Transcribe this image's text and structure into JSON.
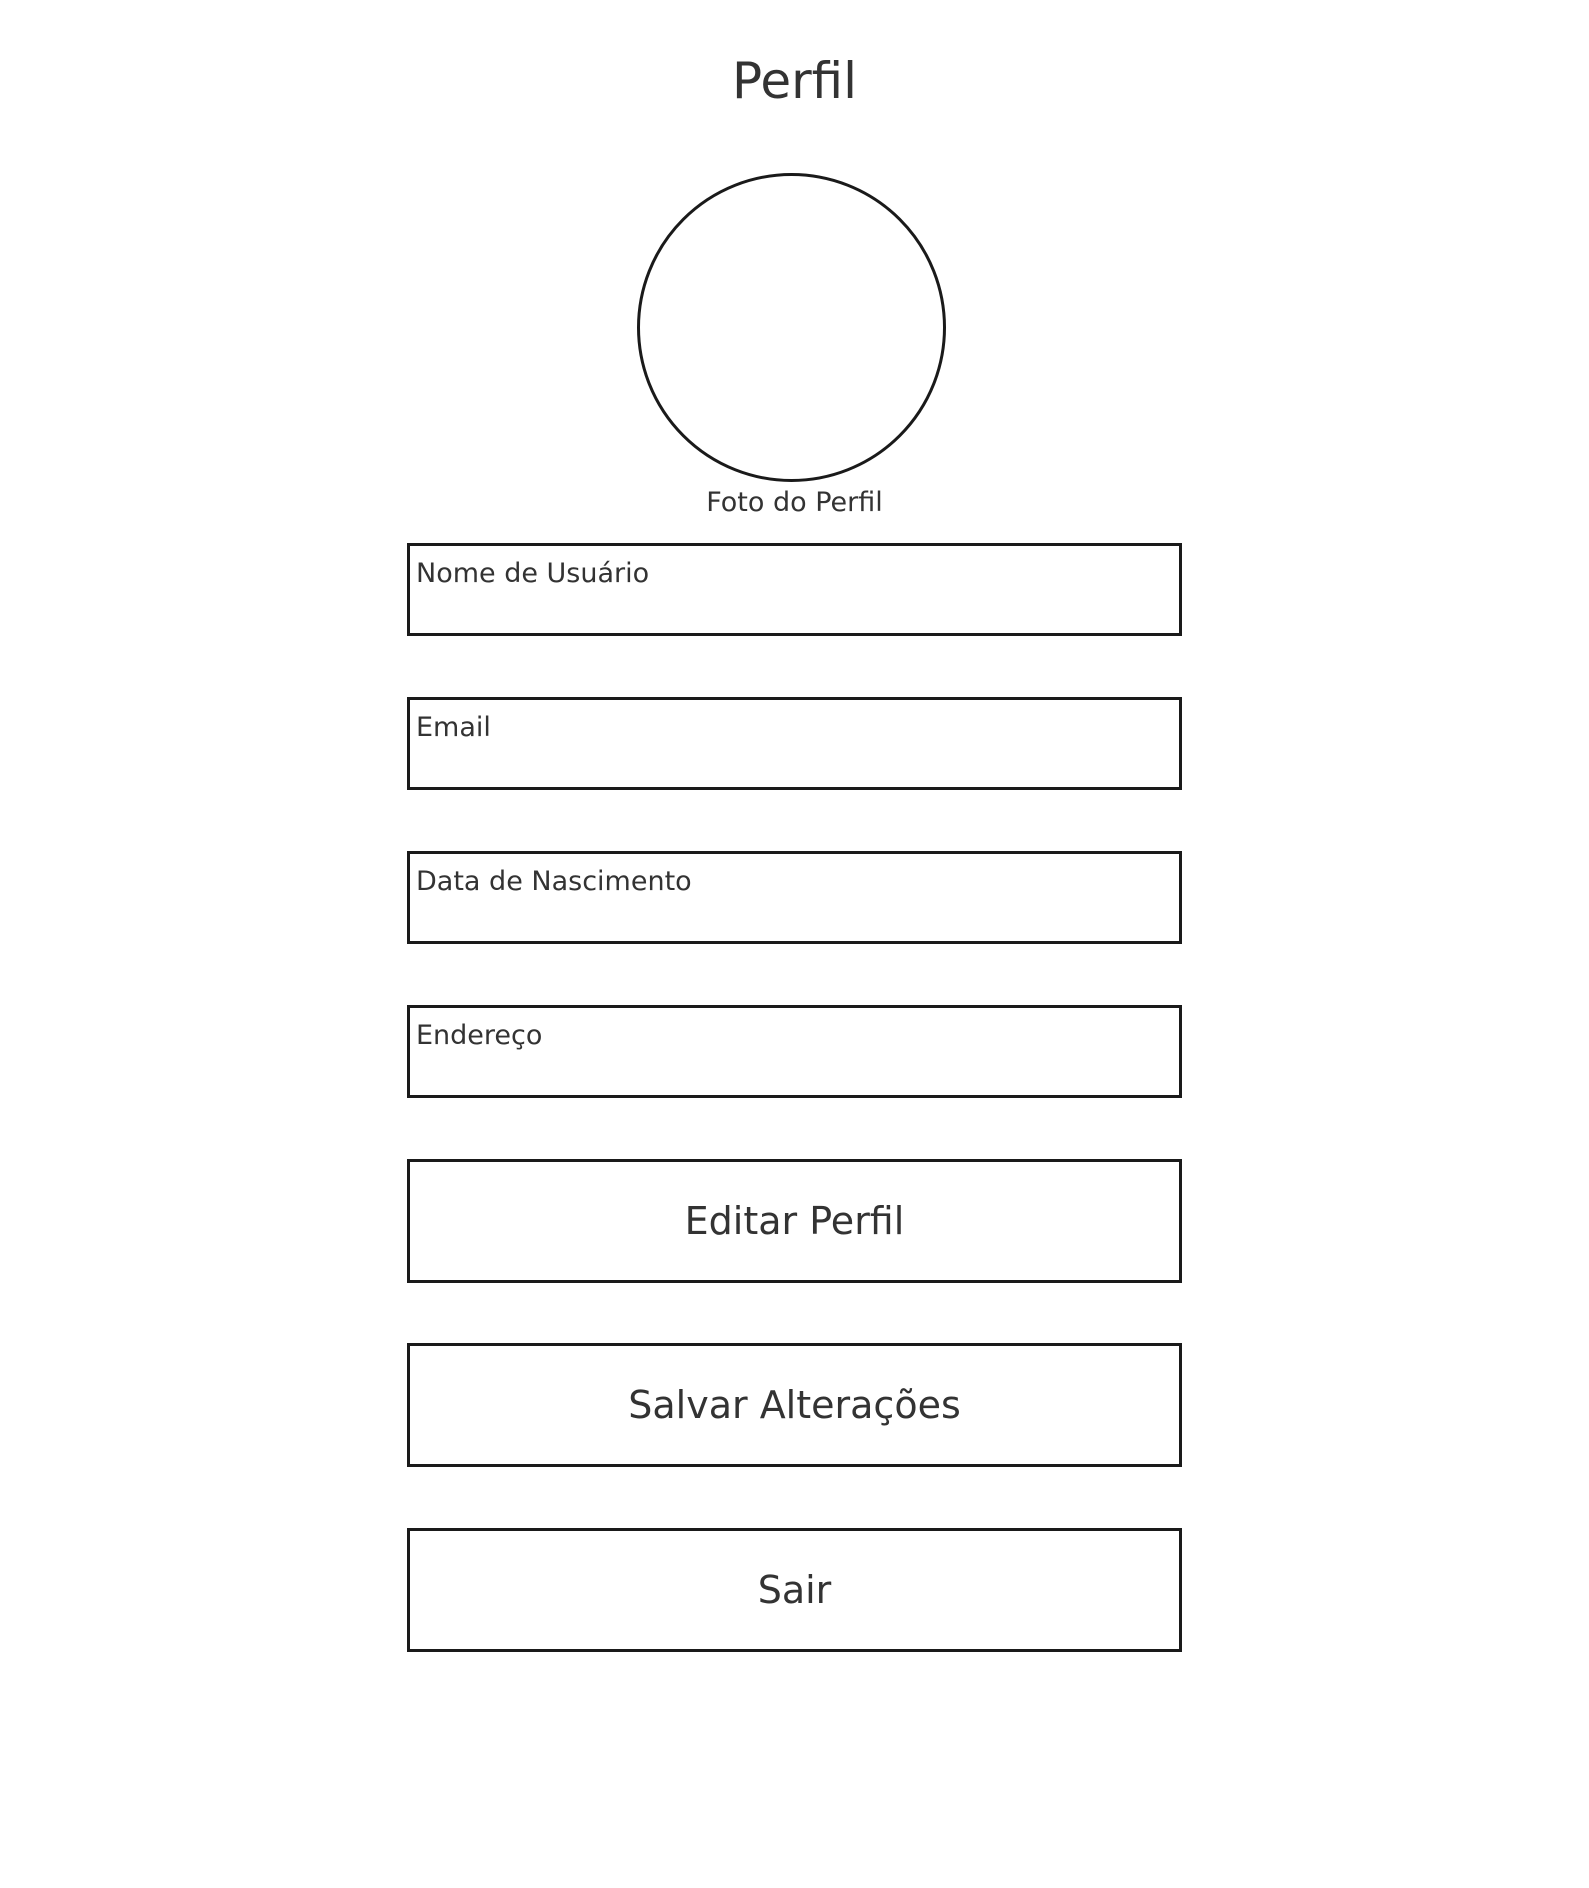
{
  "header": {
    "title": "Perfil"
  },
  "profile_photo": {
    "caption": "Foto do Perfil"
  },
  "form": {
    "fields": [
      {
        "label": "Nome de Usuário"
      },
      {
        "label": "Email"
      },
      {
        "label": "Data de Nascimento"
      },
      {
        "label": "Endereço"
      }
    ]
  },
  "actions": {
    "edit_label": "Editar Perfil",
    "save_label": "Salvar Alterações",
    "logout_label": "Sair"
  }
}
